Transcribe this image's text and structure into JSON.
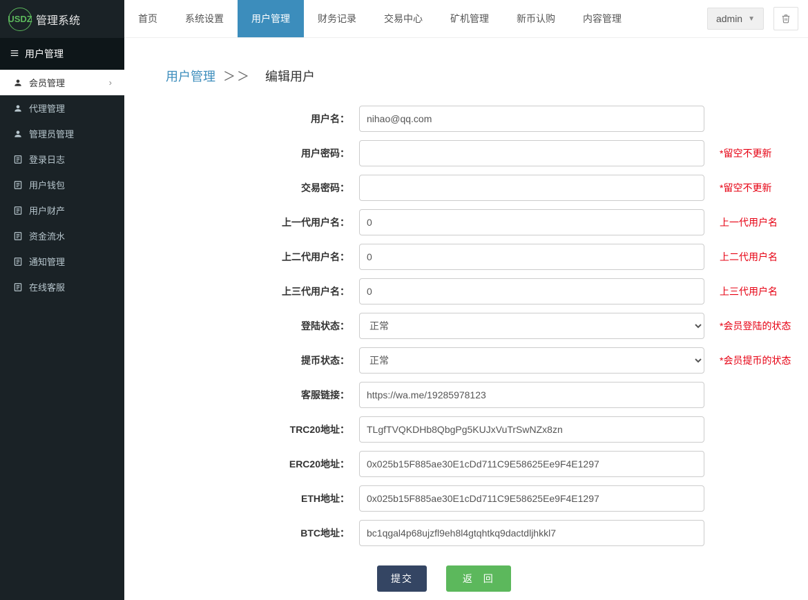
{
  "app": {
    "logo_abbr": "USDZ",
    "logo_text": "管理系统"
  },
  "nav": {
    "items": [
      "首页",
      "系统设置",
      "用户管理",
      "财务记录",
      "交易中心",
      "矿机管理",
      "新币认购",
      "内容管理"
    ],
    "active_index": 2,
    "admin_label": "admin"
  },
  "sidebar": {
    "section_title": "用户管理",
    "items": [
      {
        "label": "会员管理",
        "icon": "user",
        "active": true,
        "chevron": true
      },
      {
        "label": "代理管理",
        "icon": "user"
      },
      {
        "label": "管理员管理",
        "icon": "user"
      },
      {
        "label": "登录日志",
        "icon": "doc"
      },
      {
        "label": "用户钱包",
        "icon": "doc"
      },
      {
        "label": "用户财产",
        "icon": "doc"
      },
      {
        "label": "资金流水",
        "icon": "doc"
      },
      {
        "label": "通知管理",
        "icon": "doc"
      },
      {
        "label": "在线客服",
        "icon": "doc"
      }
    ]
  },
  "breadcrumb": {
    "link": "用户管理",
    "sep": "＞＞",
    "title": "编辑用户"
  },
  "form": {
    "username": {
      "label": "用户名：",
      "value": "nihao@qq.com"
    },
    "password": {
      "label": "用户密码：",
      "value": "",
      "hint": "*留空不更新"
    },
    "trade_password": {
      "label": "交易密码：",
      "value": "",
      "hint": "*留空不更新"
    },
    "parent1": {
      "label": "上一代用户名：",
      "value": "0",
      "hint": "上一代用户名"
    },
    "parent2": {
      "label": "上二代用户名：",
      "value": "0",
      "hint": "上二代用户名"
    },
    "parent3": {
      "label": "上三代用户名：",
      "value": "0",
      "hint": "上三代用户名"
    },
    "login_status": {
      "label": "登陆状态：",
      "value": "正常",
      "hint": "*会员登陆的状态"
    },
    "withdraw_status": {
      "label": "提币状态：",
      "value": "正常",
      "hint": "*会员提币的状态"
    },
    "service_link": {
      "label": "客服链接：",
      "value": "https://wa.me/19285978123"
    },
    "trc20": {
      "label": "TRC20地址：",
      "value": "TLgfTVQKDHb8QbgPg5KUJxVuTrSwNZx8zn"
    },
    "erc20": {
      "label": "ERC20地址：",
      "value": "0x025b15F885ae30E1cDd711C9E58625Ee9F4E1297"
    },
    "eth": {
      "label": "ETH地址：",
      "value": "0x025b15F885ae30E1cDd711C9E58625Ee9F4E1297"
    },
    "btc": {
      "label": "BTC地址：",
      "value": "bc1qgal4p68ujzfl9eh8l4gtqhtkq9dactdljhkkl7"
    }
  },
  "buttons": {
    "submit": "提交",
    "return": "返 回"
  }
}
